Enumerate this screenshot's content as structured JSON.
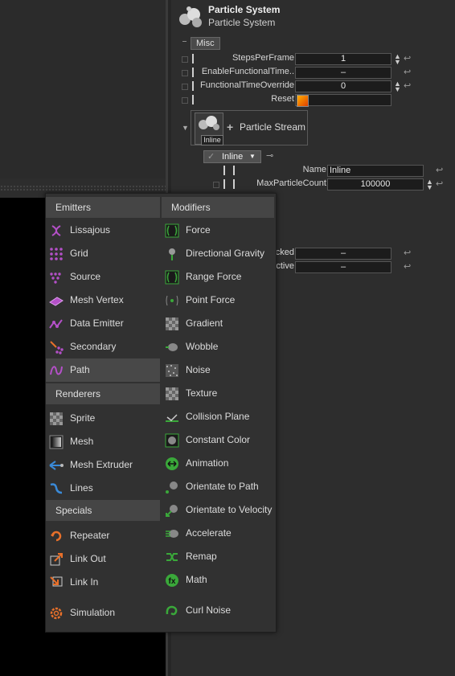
{
  "inspector": {
    "title": "Particle System",
    "subtitle": "Particle System",
    "section_tag": "Misc",
    "rows": [
      {
        "label": "StepsPerFrame",
        "value": "1"
      },
      {
        "label": "EnableFunctionalTime..",
        "value": "–"
      },
      {
        "label": "FunctionalTimeOverride",
        "value": "0"
      },
      {
        "label": "Reset",
        "value": ""
      }
    ],
    "stream": {
      "thumb_label": "Inline",
      "add_label": "Particle Stream"
    },
    "inline_dropdown": "Inline",
    "sub_rows": [
      {
        "label": "Name",
        "value": "Inline"
      },
      {
        "label": "MaxParticleCount",
        "value": "100000"
      }
    ],
    "hidden_rows": [
      {
        "label": "cked",
        "value": "–"
      },
      {
        "label": "ctive",
        "value": "–"
      }
    ]
  },
  "menu": {
    "emitters_header": "Emitters",
    "modifiers_header": "Modifiers",
    "renderers_header": "Renderers",
    "specials_header": "Specials",
    "emitters": [
      {
        "label": "Lissajous",
        "icon": "lissajous-icon"
      },
      {
        "label": "Grid",
        "icon": "grid-icon"
      },
      {
        "label": "Source",
        "icon": "source-icon"
      },
      {
        "label": "Mesh Vertex",
        "icon": "mesh-vertex-icon"
      },
      {
        "label": "Data Emitter",
        "icon": "data-emitter-icon"
      },
      {
        "label": "Secondary",
        "icon": "secondary-icon"
      },
      {
        "label": "Path",
        "icon": "path-icon"
      }
    ],
    "renderers": [
      {
        "label": "Sprite",
        "icon": "sprite-icon"
      },
      {
        "label": "Mesh",
        "icon": "mesh-icon"
      },
      {
        "label": "Mesh Extruder",
        "icon": "mesh-extruder-icon"
      },
      {
        "label": "Lines",
        "icon": "lines-icon"
      }
    ],
    "specials": [
      {
        "label": "Repeater",
        "icon": "repeater-icon"
      },
      {
        "label": "Link Out",
        "icon": "link-out-icon"
      },
      {
        "label": "Link In",
        "icon": "link-in-icon"
      },
      {
        "label": "Simulation",
        "icon": "simulation-icon"
      }
    ],
    "modifiers": [
      {
        "label": "Force",
        "icon": "force-icon"
      },
      {
        "label": "Directional Gravity",
        "icon": "directional-gravity-icon"
      },
      {
        "label": "Range Force",
        "icon": "range-force-icon"
      },
      {
        "label": "Point Force",
        "icon": "point-force-icon"
      },
      {
        "label": "Gradient",
        "icon": "gradient-icon"
      },
      {
        "label": "Wobble",
        "icon": "wobble-icon"
      },
      {
        "label": "Noise",
        "icon": "noise-icon"
      },
      {
        "label": "Texture",
        "icon": "texture-icon"
      },
      {
        "label": "Collision Plane",
        "icon": "collision-plane-icon"
      },
      {
        "label": "Constant Color",
        "icon": "constant-color-icon"
      },
      {
        "label": "Animation",
        "icon": "animation-icon"
      },
      {
        "label": "Orientate to Path",
        "icon": "orientate-to-path-icon"
      },
      {
        "label": "Orientate to Velocity",
        "icon": "orientate-to-velocity-icon"
      },
      {
        "label": "Accelerate",
        "icon": "accelerate-icon"
      },
      {
        "label": "Remap",
        "icon": "remap-icon"
      },
      {
        "label": "Math",
        "icon": "math-icon"
      },
      {
        "label": "Curl Noise",
        "icon": "curl-noise-icon"
      }
    ]
  },
  "colors": {
    "emitter_accent": "#b450c8",
    "renderer_accent": "#3a8ad8",
    "special_accent": "#e8702a",
    "modifier_accent": "#3aa83a"
  }
}
